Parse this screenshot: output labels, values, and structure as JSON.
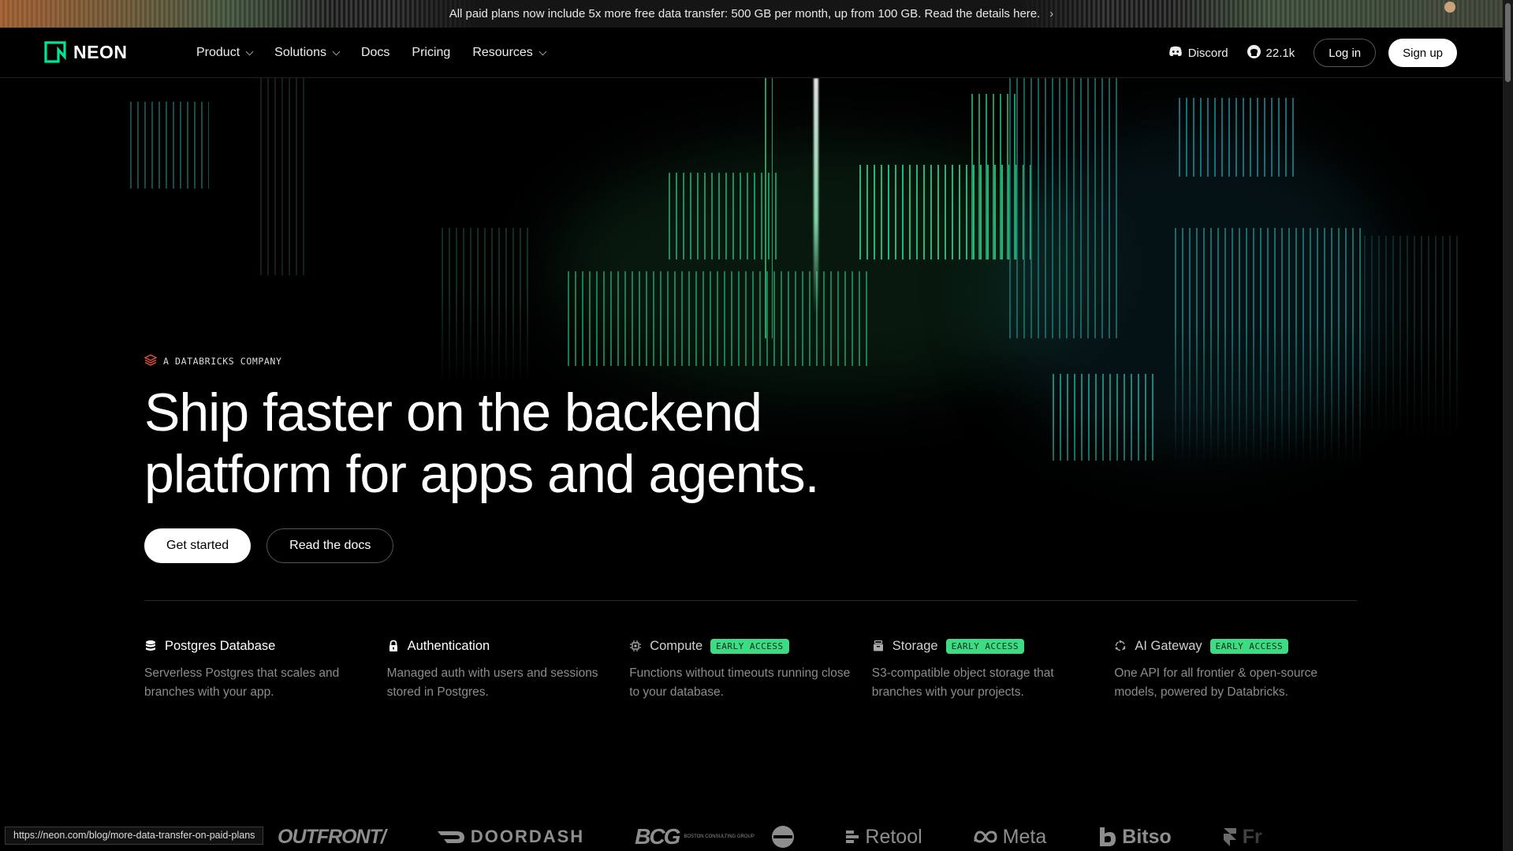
{
  "banner": {
    "text": "All paid plans now include 5x more free data transfer: 500 GB per month, up from 100 GB. Read the details here.",
    "chevron": "›"
  },
  "header": {
    "logo_text": "NEON",
    "nav": [
      {
        "label": "Product",
        "has_dropdown": true
      },
      {
        "label": "Solutions",
        "has_dropdown": true
      },
      {
        "label": "Docs",
        "has_dropdown": false
      },
      {
        "label": "Pricing",
        "has_dropdown": false
      },
      {
        "label": "Resources",
        "has_dropdown": true
      }
    ],
    "discord_label": "Discord",
    "github_stars": "22.1k",
    "login_label": "Log in",
    "signup_label": "Sign up"
  },
  "hero": {
    "eyebrow": "A DATABRICKS COMPANY",
    "headline_line1": "Ship faster on the backend",
    "headline_line2": "platform for apps and agents.",
    "primary_cta": "Get started",
    "secondary_cta": "Read the docs"
  },
  "features": [
    {
      "title": "Postgres Database",
      "badge": "",
      "description": "Serverless Postgres that scales and branches with your app.",
      "icon": "database-icon"
    },
    {
      "title": "Authentication",
      "badge": "",
      "description": "Managed auth with users and sessions stored in Postgres.",
      "icon": "lock-icon"
    },
    {
      "title": "Compute",
      "badge": "EARLY ACCESS",
      "description": "Functions without timeouts running close to your database.",
      "icon": "chip-icon"
    },
    {
      "title": "Storage",
      "badge": "EARLY ACCESS",
      "description": "S3-compatible object storage that branches with your projects.",
      "icon": "storage-icon"
    },
    {
      "title": "AI Gateway",
      "badge": "EARLY ACCESS",
      "description": "One API for all frontier & open-source models, powered by Databricks.",
      "icon": "gateway-icon"
    }
  ],
  "logos": {
    "outfront": "OUTFRONT/",
    "doordash": "DOORDASH",
    "bcg": "BCG",
    "bcg_small": "BOSTON CONSULTING GROUP",
    "pepsi": "PEPSI",
    "retool": "Retool",
    "meta": "Meta",
    "bitso": "Bitso",
    "last": "Fr"
  },
  "status_bar": {
    "url": "https://neon.com/blog/more-data-transfer-on-paid-plans"
  },
  "colors": {
    "accent_green": "#3ddc84",
    "background": "#000000",
    "logo_green": "#00e599",
    "databricks_red": "#e8533a"
  }
}
